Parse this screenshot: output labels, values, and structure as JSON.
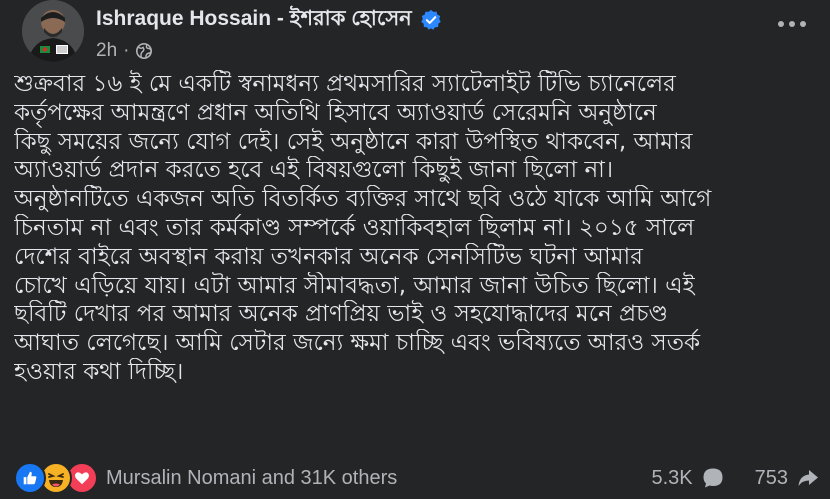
{
  "post": {
    "author_name": "Ishraque Hossain - ইশরাক হোসেন",
    "time": "2h",
    "privacy_icon": "globe-icon",
    "verified_icon": "verified-badge-icon",
    "more_icon": "more-options-icon",
    "body_lines": [
      "শুক্রবার ১৬ ই মে একটি স্বনামধন্য প্রথমসারির স্যাটেলাইট টিভি চ্যানেলের",
      "কর্তৃপক্ষের আমন্ত্রণে প্রধান অতিথি হিসাবে অ্যাওয়ার্ড সেরেমনি অনুষ্ঠানে",
      "কিছু সময়ের জন্যে যোগ দেই। সেই অনুষ্ঠানে কারা উপস্থিত থাকবেন, আমার",
      "অ্যাওয়ার্ড প্রদান করতে হবে এই বিষয়গুলো কিছুই জানা ছিলো না।",
      "অনুষ্ঠানটিতে একজন অতি বিতর্কিত ব্যক্তির সাথে ছবি ওঠে যাকে আমি আগে",
      "চিনতাম না এবং তার কর্মকাণ্ড সম্পর্কে ওয়াকিবহাল ছিলাম না। ২০১৫ সালে",
      "দেশের বাইরে অবস্থান করায় তখনকার অনেক সেনসিটিভ ঘটনা আমার",
      "চোখে এড়িয়ে যায়। এটা আমার সীমাবদ্ধতা, আমার জানা উচিত ছিলো। এই",
      "ছবিটি দেখার পর আমার অনেক প্রাণপ্রিয় ভাই ও সহযোদ্ধাদের মনে প্রচণ্ড",
      "আঘাত লেগেছে। আমি সেটার জন্যে ক্ষমা চাচ্ছি এবং ভবিষ্যতে আরও সতর্ক",
      "হওয়ার কথা দিচ্ছি।"
    ]
  },
  "footer": {
    "reaction_icons": [
      "like-icon",
      "haha-icon",
      "love-icon"
    ],
    "reactions_text": "Mursalin Nomani and 31K others",
    "comments_count": "5.3K",
    "comment_icon": "comment-icon",
    "shares_count": "753",
    "share_icon": "share-icon"
  },
  "colors": {
    "background": "#242526",
    "text_primary": "#e4e6eb",
    "text_secondary": "#b0b3b8",
    "verified_blue": "#2d88ff",
    "like_blue": "#1877f2",
    "love_red": "#f33e58",
    "haha_yellow": "#f7b125"
  }
}
